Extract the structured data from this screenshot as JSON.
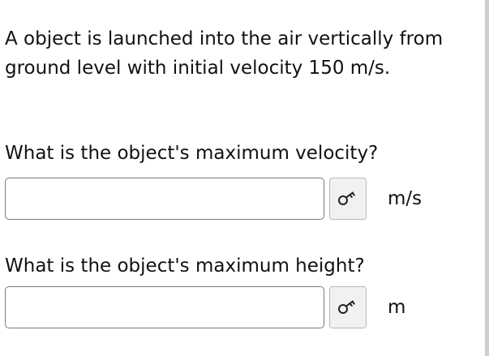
{
  "question": {
    "text": "A object is launched into the air vertically from ground level with initial velocity 150 m/s."
  },
  "parts": [
    {
      "prompt": "What is the object's maximum velocity?",
      "input_value": "",
      "unit": "m/s",
      "key_icon": "key-icon"
    },
    {
      "prompt": "What is the object's maximum height?",
      "input_value": "",
      "unit": "m",
      "key_icon": "key-icon"
    }
  ],
  "colors": {
    "input_border": "#7a7a7a",
    "button_background": "#f1f1f1",
    "scrollbar": "#cfcfcf"
  }
}
